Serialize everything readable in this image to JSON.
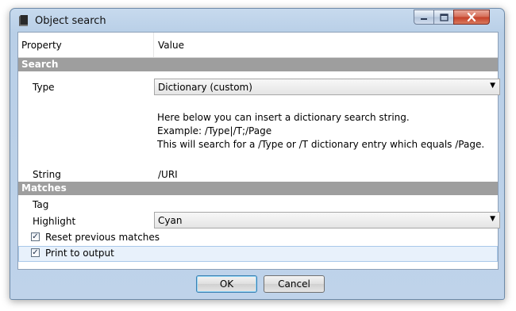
{
  "window": {
    "title": "Object search",
    "icon": "book-icon",
    "controls": [
      "minimize-icon",
      "maximize-icon",
      "close-icon"
    ]
  },
  "table": {
    "headers": {
      "property": "Property",
      "value": "Value"
    },
    "sections": {
      "search": "Search",
      "matches": "Matches"
    },
    "type": {
      "label": "Type",
      "value": "Dictionary (custom)",
      "description": [
        "Here below you can insert a dictionary search string.",
        "Example: /Type|/T;/Page",
        "This will search for a /Type or /T dictionary entry which equals /Page."
      ]
    },
    "string": {
      "label": "String",
      "value": "/URI"
    },
    "tag": {
      "label": "Tag",
      "value": ""
    },
    "highlight": {
      "label": "Highlight",
      "value": "Cyan"
    },
    "reset": {
      "label": "Reset previous matches",
      "checked": true,
      "mark": "✓"
    },
    "print": {
      "label": "Print to output",
      "checked": true,
      "mark": "✓"
    }
  },
  "buttons": {
    "ok": "OK",
    "cancel": "Cancel"
  },
  "colors": {
    "section_header": "#9e9e9e",
    "selected_row": "#e8f1fb",
    "frame": "#bfd3ea"
  }
}
